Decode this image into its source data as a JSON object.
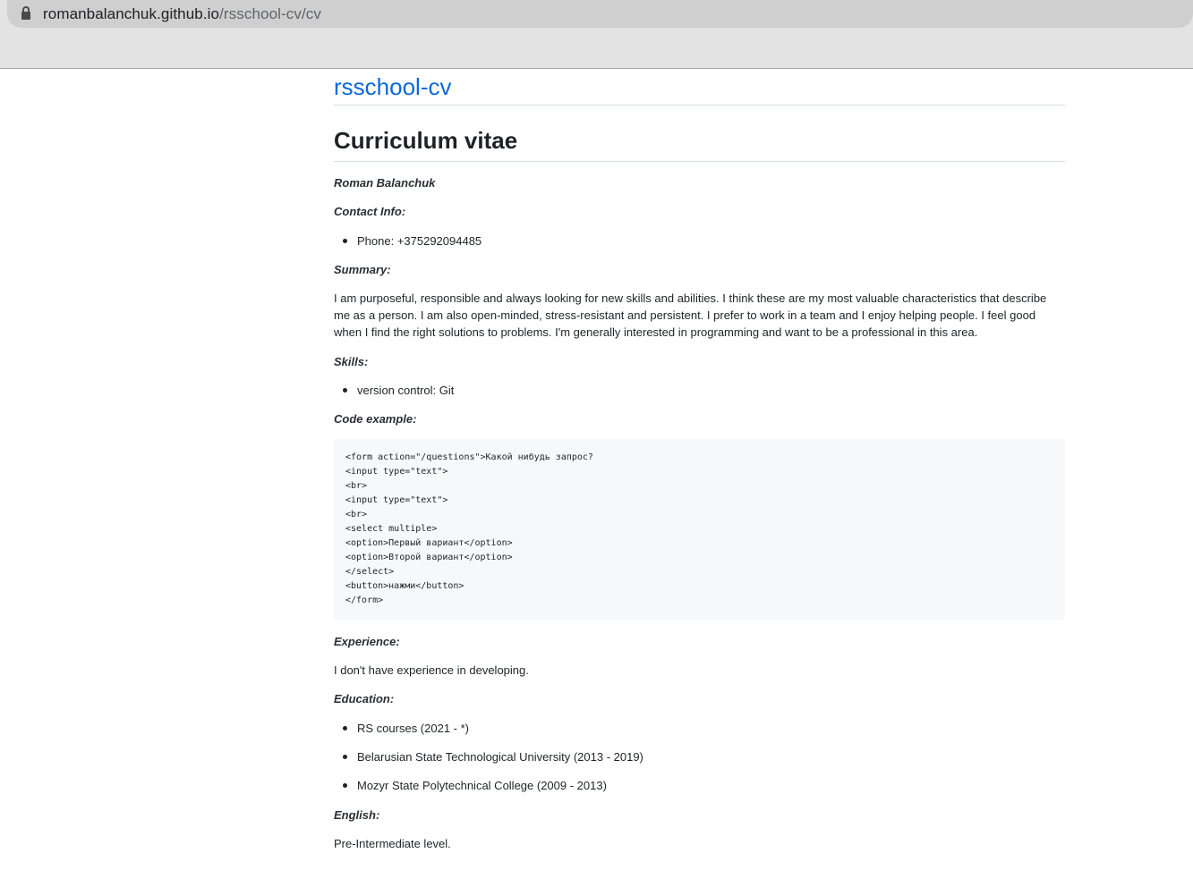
{
  "browser": {
    "url_host": "romanbalanchuk.github.io",
    "url_path": "/rsschool-cv/cv"
  },
  "site": {
    "title": "rsschool-cv"
  },
  "cv": {
    "heading": "Curriculum vitae",
    "name": "Roman Balanchuk",
    "contact_label": "Contact Info:",
    "contact_items": [
      "Phone: +375292094485"
    ],
    "summary_label": "Summary:",
    "summary_text": "I am purposeful, responsible and always looking for new skills and abilities. I think these are my most valuable characteristics that describe me as a person. I am also open-minded, stress-resistant and persistent. I prefer to work in a team and I enjoy helping people. I feel good when I find the right solutions to problems. I'm generally interested in programming and want to be a professional in this area.",
    "skills_label": "Skills:",
    "skills_items": [
      "version control: Git"
    ],
    "code_label": "Code example:",
    "code_text": "<form action=\"/questions\">Какой нибудь запрос?\n<input type=\"text\">\n<br>\n<input type=\"text\">\n<br>\n<select multiple>\n<option>Первый вариант</option>\n<option>Второй вариант</option>\n</select>\n<button>нажми</button>\n</form>",
    "experience_label": "Experience:",
    "experience_text": "I don't have experience in developing.",
    "education_label": "Education:",
    "education_items": [
      "RS courses (2021 - *)",
      "Belarusian State Technological University (2013 - 2019)",
      "Mozyr State Polytechnical College (2009 - 2013)"
    ],
    "english_label": "English:",
    "english_text": "Pre-Intermediate level."
  }
}
